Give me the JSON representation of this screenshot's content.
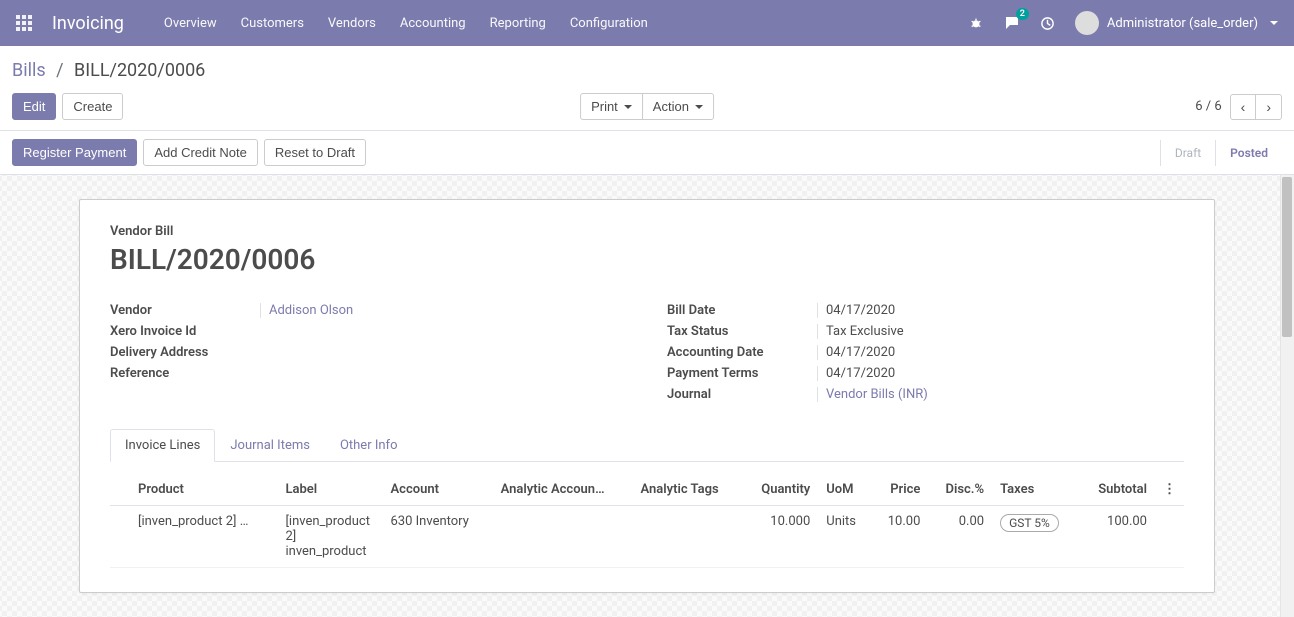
{
  "app": {
    "title": "Invoicing"
  },
  "topnav": {
    "overview": "Overview",
    "customers": "Customers",
    "vendors": "Vendors",
    "accounting": "Accounting",
    "reporting": "Reporting",
    "configuration": "Configuration"
  },
  "header": {
    "chat_count": "2",
    "user_name": "Administrator (sale_order)"
  },
  "breadcrumb": {
    "root": "Bills",
    "sep": "/",
    "current": "BILL/2020/0006"
  },
  "buttons": {
    "edit": "Edit",
    "create": "Create",
    "print": "Print",
    "action": "Action",
    "register_payment": "Register Payment",
    "add_credit_note": "Add Credit Note",
    "reset_to_draft": "Reset to Draft"
  },
  "pager": {
    "text": "6 / 6"
  },
  "status": {
    "draft": "Draft",
    "posted": "Posted"
  },
  "sheet": {
    "subtitle": "Vendor Bill",
    "title": "BILL/2020/0006",
    "left": {
      "vendor_label": "Vendor",
      "vendor_value": "Addison Olson",
      "xero_label": "Xero Invoice Id",
      "delivery_label": "Delivery Address",
      "reference_label": "Reference"
    },
    "right": {
      "bill_date_label": "Bill Date",
      "bill_date_value": "04/17/2020",
      "tax_status_label": "Tax Status",
      "tax_status_value": "Tax Exclusive",
      "accounting_date_label": "Accounting Date",
      "accounting_date_value": "04/17/2020",
      "payment_terms_label": "Payment Terms",
      "payment_terms_value": "04/17/2020",
      "journal_label": "Journal",
      "journal_value": "Vendor Bills (INR)"
    }
  },
  "tabs": {
    "invoice_lines": "Invoice Lines",
    "journal_items": "Journal Items",
    "other_info": "Other Info"
  },
  "table": {
    "headers": {
      "product": "Product",
      "label": "Label",
      "account": "Account",
      "analytic_account": "Analytic Accoun…",
      "analytic_tags": "Analytic Tags",
      "quantity": "Quantity",
      "uom": "UoM",
      "price": "Price",
      "disc": "Disc.%",
      "taxes": "Taxes",
      "subtotal": "Subtotal"
    },
    "row1": {
      "product": "[inven_product 2] …",
      "label": "[inven_product 2] inven_product",
      "account": "630 Inventory",
      "quantity": "10.000",
      "uom": "Units",
      "price": "10.00",
      "disc": "0.00",
      "taxes": "GST 5%",
      "subtotal": "100.00"
    }
  }
}
